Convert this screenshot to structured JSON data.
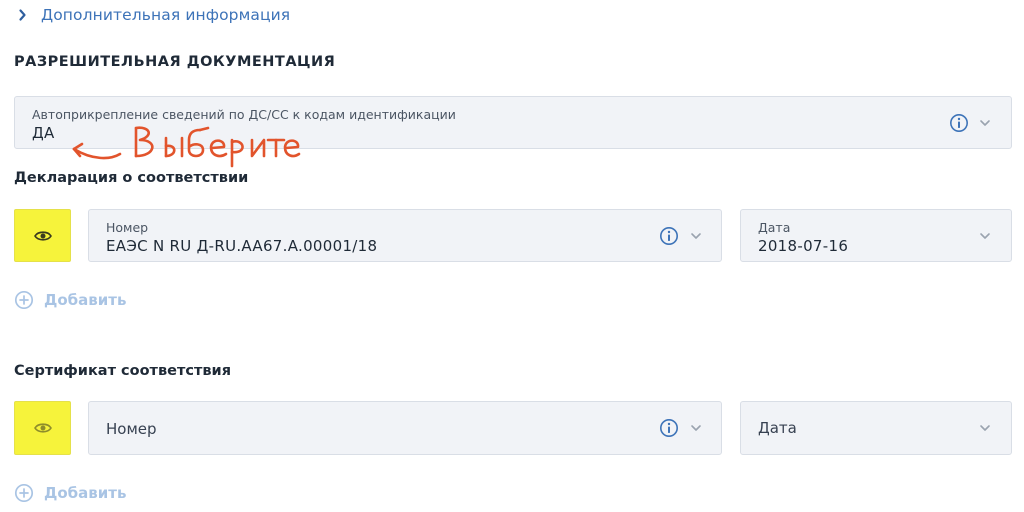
{
  "additional_info": {
    "label": "Дополнительная информация",
    "icon": "chevron-right-icon"
  },
  "permits": {
    "title": "РАЗРЕШИТЕЛЬНАЯ ДОКУМЕНТАЦИЯ",
    "auto_attach": {
      "label": "Автоприкрепление сведений по ДС/СС к кодам идентификации",
      "value": "ДА"
    },
    "annotation": {
      "text": "Выберите",
      "color": "#e2542c"
    }
  },
  "declaration": {
    "title": "Декларация о соответствии",
    "number_label": "Номер",
    "number_value": "ЕАЭС N RU Д-RU.AA67.A.00001/18",
    "date_label": "Дата",
    "date_value": "2018-07-16",
    "add_label": "Добавить"
  },
  "certificate": {
    "title": "Сертификат соответствия",
    "number_placeholder": "Номер",
    "date_placeholder": "Дата",
    "add_label": "Добавить"
  },
  "colors": {
    "accent_link": "#3d73b8",
    "field_bg": "#f1f3f7",
    "highlight_yellow": "#f6f33b",
    "add_disabled": "#a9c4e4",
    "info_icon": "#3d73b8"
  }
}
